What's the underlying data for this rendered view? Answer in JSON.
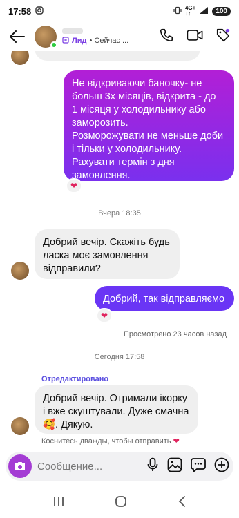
{
  "status": {
    "time": "17:58",
    "net_top": "4G+",
    "net_bottom": "↓↑",
    "battery": "100"
  },
  "header": {
    "lead": "Лид",
    "sub": "• Сейчас ..."
  },
  "messages": {
    "out1": [
      "Не відкриваючи баночку-  не",
      "больш 3х місяців, відкрита - до",
      "1 місяця у холодильнику або",
      "заморозить.",
      "Розморожувати не меньше доби",
      "і тільки у холодильнику.",
      "Рахувати термін з дня",
      "замовлення."
    ],
    "stamp1": "Вчера 18:35",
    "in1": [
      "Добрий вечір. Скажіть будь",
      "ласка моє замовлення",
      "відправили?"
    ],
    "out2": "Добрий, так відправляємо",
    "seen": "Просмотрено 23 часов назад",
    "stamp2": "Сегодня 17:58",
    "edited": "Отредактировано",
    "in2": [
      "Добрий вечір. Отримали ікорку",
      "і вже скуштували. Дуже смачна",
      "🥰. Дякую."
    ],
    "hint": "Коснитесь дважды, чтобы отправить",
    "hint_heart": "❤",
    "react_heart": "❤"
  },
  "composer": {
    "placeholder": "Сообщение..."
  },
  "colors": {
    "gradient_top": "#b21fd6",
    "gradient_bottom": "#6a35f5",
    "camera": "#a43cd4"
  }
}
